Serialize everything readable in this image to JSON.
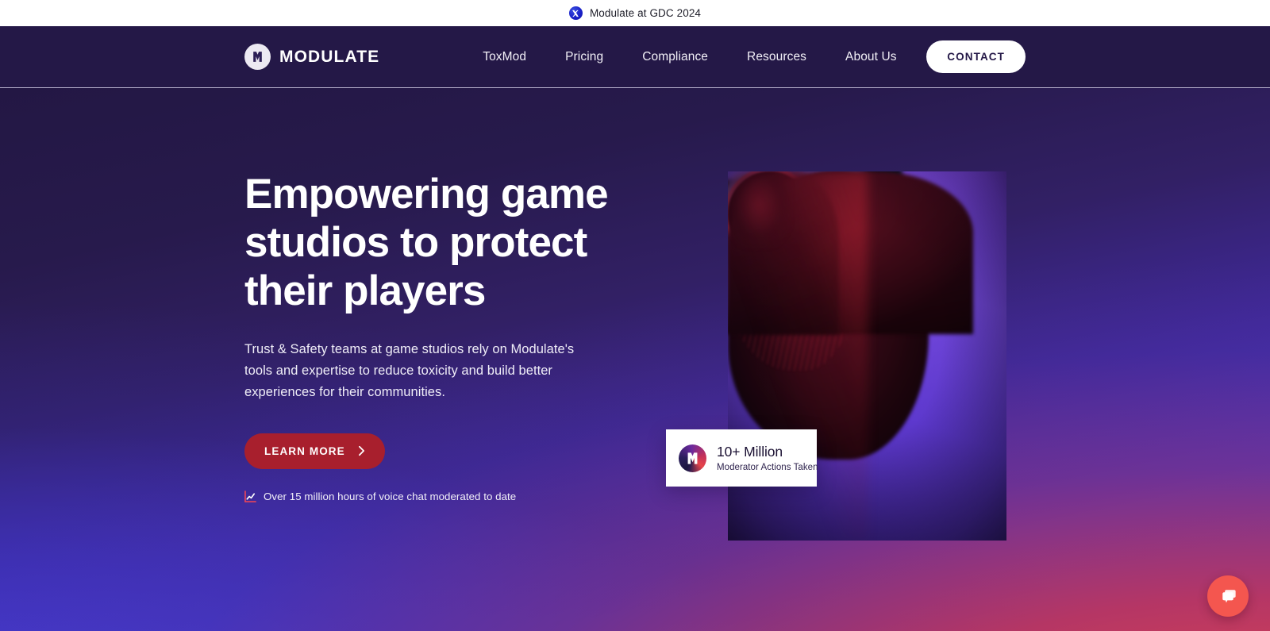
{
  "announcement": {
    "icon": "x-twitter-icon",
    "text": "Modulate at GDC 2024"
  },
  "header": {
    "logo_icon": "modulate-m-logo-icon",
    "logo_text": "MODULATE",
    "nav": [
      {
        "label": "ToxMod"
      },
      {
        "label": "Pricing"
      },
      {
        "label": "Compliance"
      },
      {
        "label": "Resources"
      },
      {
        "label": "About Us"
      }
    ],
    "contact_label": "CONTACT"
  },
  "hero": {
    "title": "Empowering game studios to protect their players",
    "subtitle": "Trust & Safety teams at game studios rely on Modulate's tools and expertise to reduce toxicity and build better experiences for their communities.",
    "cta_label": "LEARN MORE",
    "cta_icon": "chevron-right-icon",
    "stat_icon": "trend-chart-icon",
    "stat_text": "Over 15 million hours of voice chat moderated to date",
    "image_alt": "Gamer wearing headphones seated at a purple-lit desk, viewed from behind"
  },
  "stat_card": {
    "logo_icon": "modulate-m-logo-icon",
    "value": "10+ Million",
    "label": "Moderator Actions Taken"
  },
  "chat_widget": {
    "icon": "chat-bubbles-icon"
  },
  "colors": {
    "header_bg": "#241847",
    "announcement_bg": "#ffffff",
    "cta_red": "#a81f2d",
    "chat_coral": "#f4564f",
    "hero_blue": "#4838d7",
    "hero_crimson": "#cd344d",
    "hero_navy": "#231744"
  }
}
